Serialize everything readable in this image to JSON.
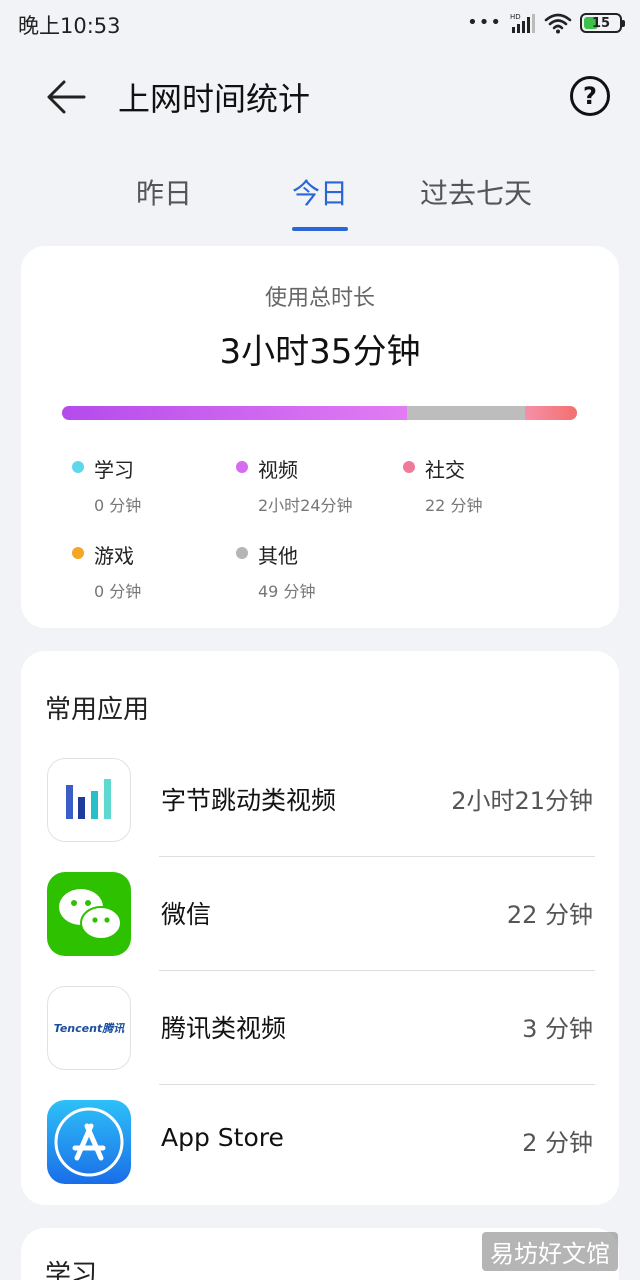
{
  "status_bar": {
    "time": "晚上10:53",
    "network_label": "HD",
    "battery": "15"
  },
  "header": {
    "title": "上网时间统计"
  },
  "tabs": [
    {
      "label": "昨日",
      "active": false
    },
    {
      "label": "今日",
      "active": true
    },
    {
      "label": "过去七天",
      "active": false
    }
  ],
  "summary": {
    "label": "使用总时长",
    "total": "3小时35分钟",
    "bar_fractions": {
      "study": 0.0,
      "video": 0.67,
      "social": 0.1,
      "game": 0.0,
      "other": 0.23
    },
    "legend": [
      {
        "name": "学习",
        "value": "0 分钟",
        "color": "#5fd6ea"
      },
      {
        "name": "视频",
        "value": "2小时24分钟",
        "color": "#d66cf0"
      },
      {
        "name": "社交",
        "value": "22 分钟",
        "color": "#f07a9a"
      },
      {
        "name": "游戏",
        "value": "0 分钟",
        "color": "#f5a623"
      },
      {
        "name": "其他",
        "value": "49 分钟",
        "color": "#b5b5b5"
      }
    ]
  },
  "apps": {
    "title": "常用应用",
    "items": [
      {
        "name": "字节跳动类视频",
        "time": "2小时21分钟",
        "icon": "bytedance-icon"
      },
      {
        "name": "微信",
        "time": "22 分钟",
        "icon": "wechat-icon"
      },
      {
        "name": "腾讯类视频",
        "time": "3 分钟",
        "icon": "tencent-icon",
        "icon_text": "Tencent腾讯"
      },
      {
        "name": "App Store",
        "time": "2 分钟",
        "icon": "app-store-icon"
      }
    ]
  },
  "next_section": {
    "title": "学习"
  },
  "watermark": "易坊好文馆"
}
